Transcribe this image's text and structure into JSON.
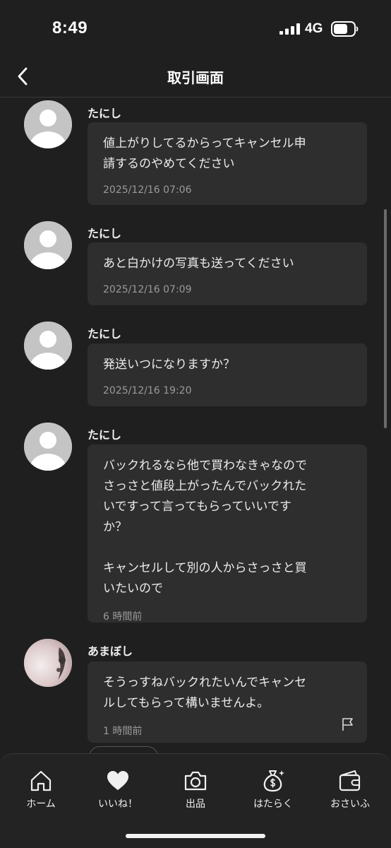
{
  "status_bar": {
    "time": "8:49",
    "network": "4G"
  },
  "header": {
    "title": "取引画面"
  },
  "messages": [
    {
      "sender": "たにし",
      "text": "値上がりしてるからってキャンセル申\n請するのやめてください",
      "time": "2025/12/16 07:06"
    },
    {
      "sender": "たにし",
      "text": "あと白かけの写真も送ってください",
      "time": "2025/12/16 07:09"
    },
    {
      "sender": "たにし",
      "text": "発送いつになりますか？",
      "time": "2025/12/16 19:20"
    },
    {
      "sender": "たにし",
      "text": "バックれるなら他で買わなきゃなので\nさっさと値段上がったんでバックれた\nいですって言ってもらっていいです\nか？\n\nキャンセルして別の人からさっさと買\nいたいので",
      "time": "6 時間前"
    },
    {
      "sender": "あまぼし",
      "text": "そうっすねバックれたいんでキャンセ\nルしてもらって構いませんよ。",
      "time": "1 時間前"
    }
  ],
  "tabs": [
    {
      "label": "ホーム",
      "icon": "home-icon"
    },
    {
      "label": "いいね！",
      "icon": "heart-icon"
    },
    {
      "label": "出品",
      "icon": "camera-icon"
    },
    {
      "label": "はたらく",
      "icon": "money-bag-icon"
    },
    {
      "label": "おさいふ",
      "icon": "wallet-icon"
    }
  ]
}
